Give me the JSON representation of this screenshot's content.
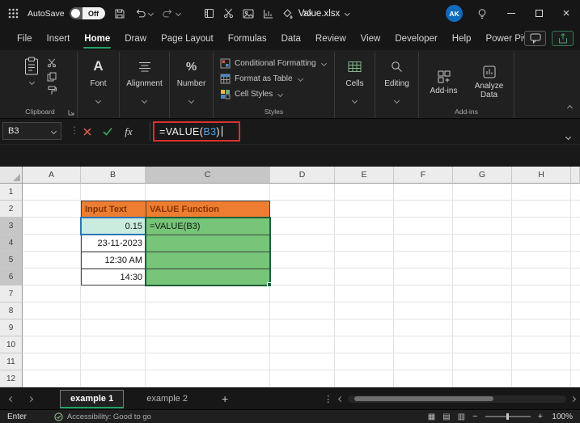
{
  "titlebar": {
    "autosave_label": "AutoSave",
    "autosave_state": "Off",
    "document_title": "Value.xlsx",
    "avatar_initials": "AK"
  },
  "menubar": {
    "tabs": [
      "File",
      "Insert",
      "Home",
      "Draw",
      "Page Layout",
      "Formulas",
      "Data",
      "Review",
      "View",
      "Developer",
      "Help",
      "Power Pivot"
    ],
    "active_tab": "Home"
  },
  "ribbon": {
    "font_icon": "A",
    "number_icon": "%",
    "styles_items": [
      "Conditional Formatting",
      "Format as Table",
      "Cell Styles"
    ],
    "collapsed": {
      "font": "Font",
      "alignment": "Alignment",
      "number": "Number",
      "cells": "Cells",
      "editing": "Editing",
      "addins_button": "Add-ins"
    },
    "analyze_data": "Analyze Data",
    "groups": {
      "clipboard": "Clipboard",
      "styles": "Styles",
      "addins": "Add-ins"
    }
  },
  "formula_bar": {
    "name_box": "B3",
    "fx_label": "fx",
    "formula_prefix": "=VALUE(",
    "formula_ref": "B3",
    "formula_suffix": ")"
  },
  "grid": {
    "columns": [
      "A",
      "B",
      "C",
      "D",
      "E",
      "F",
      "G",
      "H"
    ],
    "rows": [
      "1",
      "2",
      "3",
      "4",
      "5",
      "6",
      "7",
      "8",
      "9",
      "10",
      "11",
      "12"
    ],
    "selected_column": "C",
    "selected_range": "C3:C6",
    "table": {
      "header_input": "Input Text",
      "header_value": "VALUE Function",
      "b3": "0.15",
      "b4": "23-11-2023",
      "b5": "12:30 AM",
      "b6": "14:30",
      "c3": "=VALUE(B3)"
    }
  },
  "sheet_tabs": {
    "tabs": [
      "example 1",
      "example 2"
    ],
    "active_tab": "example 1",
    "add_button": "+"
  },
  "status_bar": {
    "mode": "Enter",
    "accessibility_text": "Accessibility: Good to go",
    "zoom_level": "100%"
  },
  "colors": {
    "excel_green": "#21a366",
    "orange_fill": "#ed7d31",
    "orange_text": "#833400",
    "green_fill": "#77c578",
    "selection_green": "#1b5e39",
    "reference_blue": "#2e75b6",
    "reference_fill": "#c9ecdf",
    "annotation_red": "#d93030",
    "avatar_blue": "#0f6cbd"
  }
}
